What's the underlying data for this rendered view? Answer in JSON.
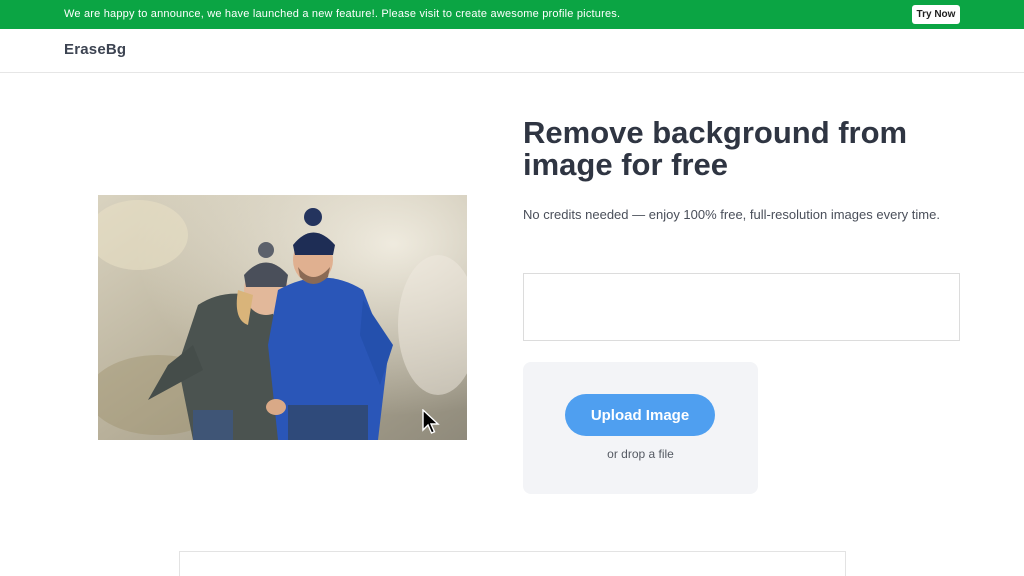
{
  "announcement": {
    "text": "We are happy to announce, we have launched a new feature!. Please visit to create awesome profile pictures.",
    "button_label": "Try Now",
    "background_color": "#0ba544"
  },
  "navbar": {
    "brand": "EraseBg"
  },
  "hero": {
    "title": "Remove background from image for free",
    "subtitle": "No credits needed — enjoy 100% free, full-resolution images every time.",
    "image_icon": "photo-of-couple-icon"
  },
  "url_input": {
    "value": "",
    "placeholder": ""
  },
  "upload": {
    "button_label": "Upload Image",
    "drop_text": "or drop a file",
    "button_color": "#4f9ff0"
  }
}
